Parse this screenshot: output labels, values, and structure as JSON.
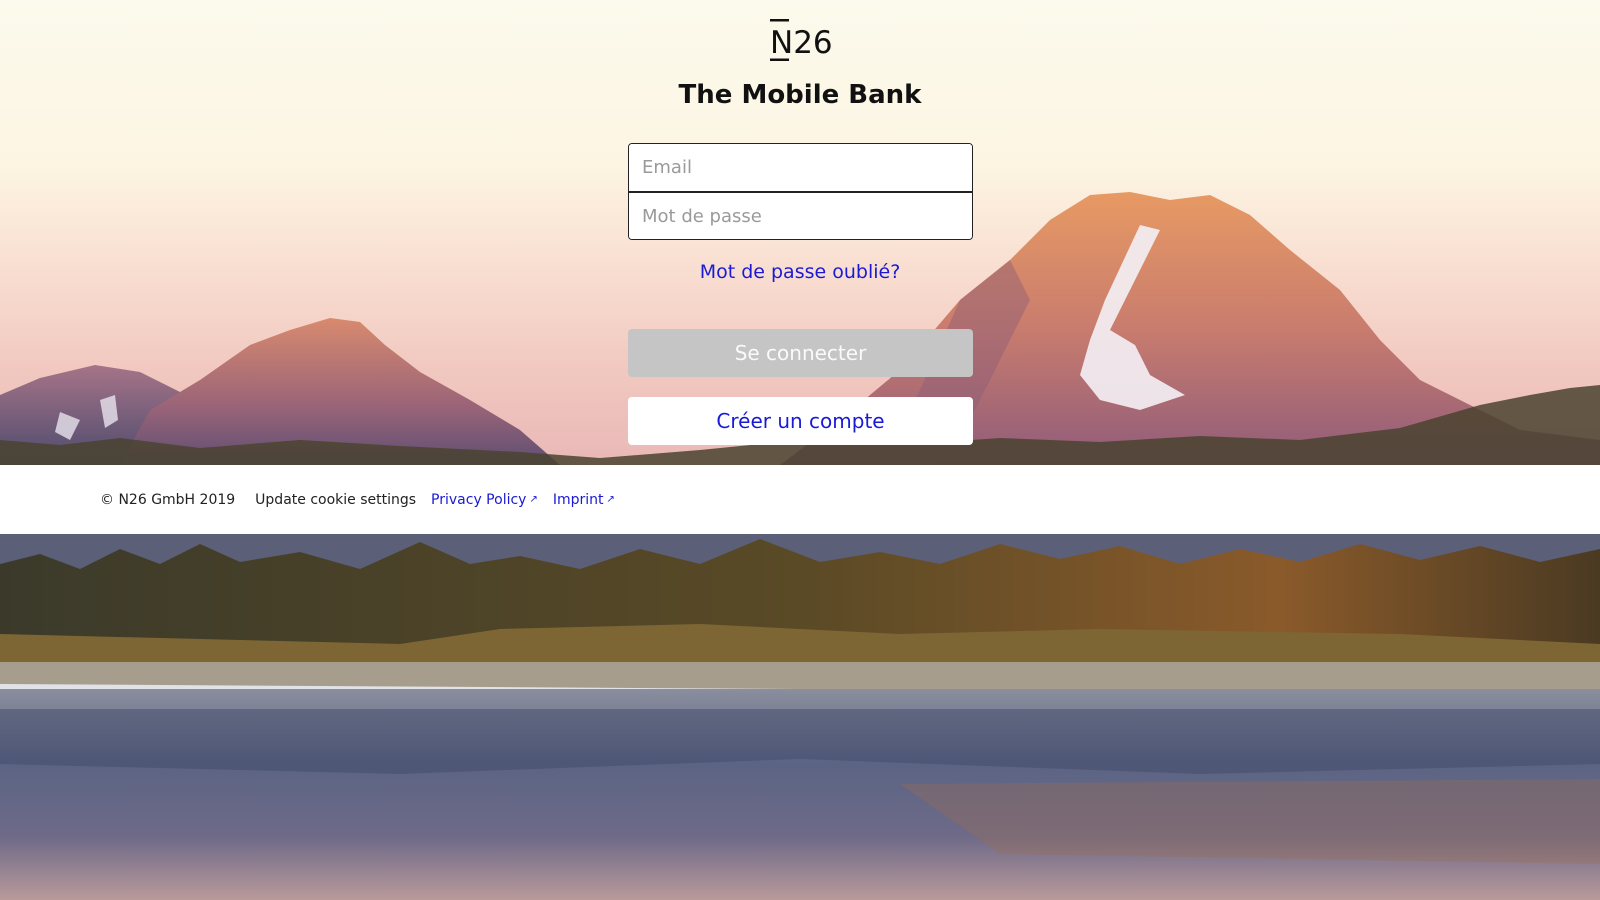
{
  "brand": {
    "logo_text": "N26",
    "headline": "The Mobile Bank"
  },
  "login_form": {
    "email_placeholder": "Email",
    "password_placeholder": "Mot de passe",
    "forgot_password_label": "Mot de passe oublié?",
    "login_button_label": "Se connecter",
    "create_account_label": "Créer un compte"
  },
  "footer": {
    "copyright": "© N26 GmbH 2019",
    "cookie_settings": "Update cookie settings",
    "privacy_policy": "Privacy Policy",
    "imprint": "Imprint",
    "external_icon": "↗"
  },
  "colors": {
    "link": "#1a1ad6",
    "login_button_disabled": "#c5c5c5",
    "text": "#111111"
  },
  "icons": {
    "external_link": "external-link-icon",
    "logo": "n26-logo-icon"
  }
}
